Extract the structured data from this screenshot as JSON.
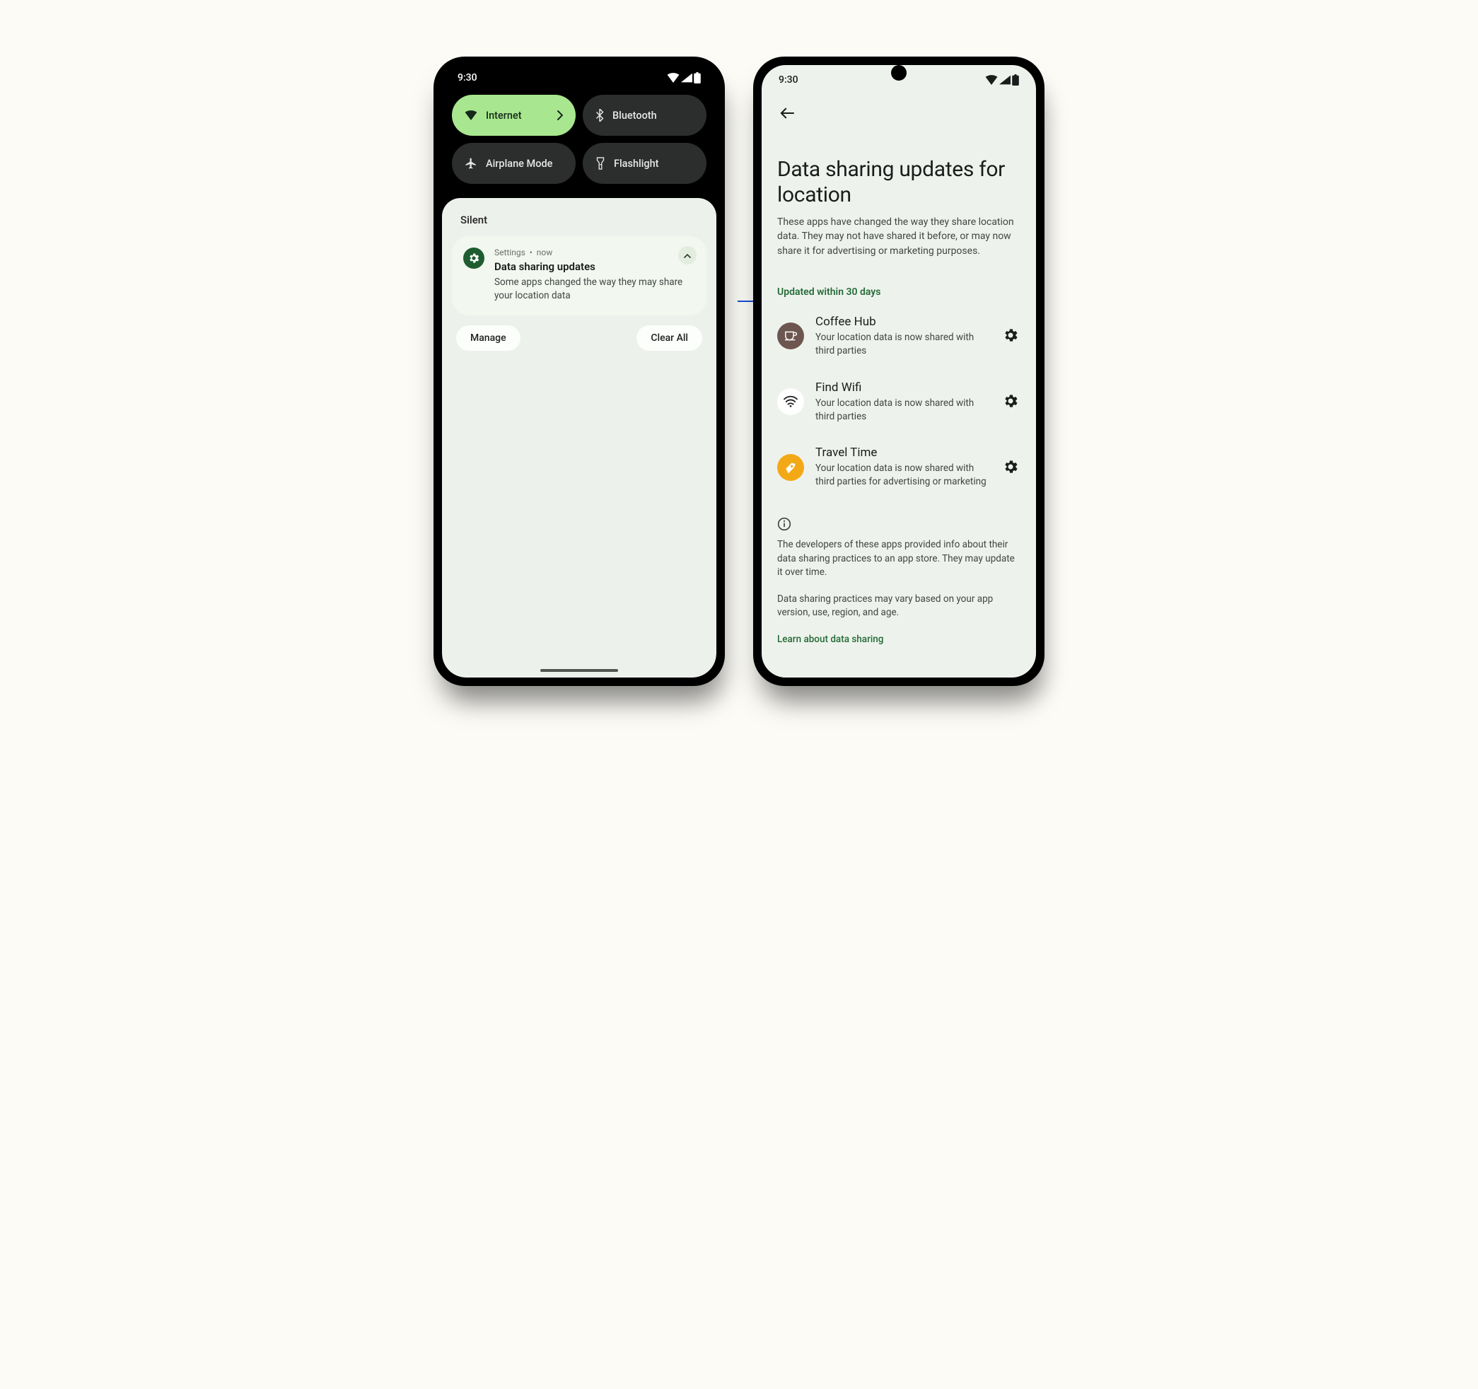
{
  "status": {
    "time": "9:30"
  },
  "shade": {
    "tiles": {
      "internet": "Internet",
      "bluetooth": "Bluetooth",
      "airplane": "Airplane Mode",
      "flashlight": "Flashlight"
    },
    "silent_label": "Silent",
    "notification": {
      "app": "Settings",
      "sep": "•",
      "time": "now",
      "title": "Data sharing updates",
      "body": "Some apps changed the way they may share your location data"
    },
    "manage": "Manage",
    "clear_all": "Clear All"
  },
  "settings": {
    "title": "Data sharing updates for location",
    "subtitle": "These apps have changed the way they share location data. They may not have shared it before, or may now share it for advertising or marketing purposes.",
    "section_label": "Updated within 30 days",
    "apps": [
      {
        "name": "Coffee Hub",
        "desc": "Your location data is now shared with third parties"
      },
      {
        "name": "Find Wifi",
        "desc": "Your location data is now shared with third parties"
      },
      {
        "name": "Travel Time",
        "desc": "Your location data is now shared with third parties for advertising or marketing"
      }
    ],
    "info1": "The developers of these apps provided info about their data sharing practices to an app store. They may update it over time.",
    "info2": "Data sharing practices may vary based on your app version, use, region, and age.",
    "learn": "Learn about data sharing"
  }
}
